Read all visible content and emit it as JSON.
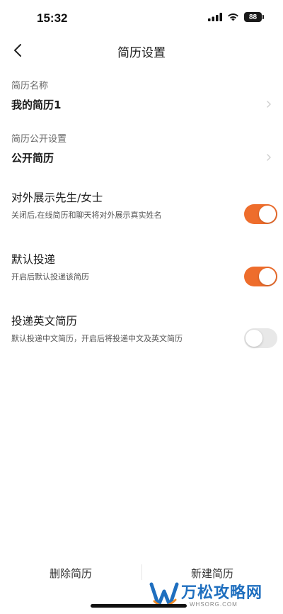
{
  "status_bar": {
    "time": "15:32",
    "battery": "88",
    "icons": [
      "signal-icon",
      "wifi-icon",
      "battery-icon"
    ]
  },
  "header": {
    "back_icon": "chevron-left-icon",
    "title": "简历设置"
  },
  "resume_name": {
    "label": "简历名称",
    "value": "我的简历1"
  },
  "visibility": {
    "label": "简历公开设置",
    "value": "公开简历"
  },
  "toggles": [
    {
      "title": "对外展示先生/女士",
      "description": "关闭后,在线简历和聊天将对外展示真实姓名",
      "enabled": true
    },
    {
      "title": "默认投递",
      "description": "开启后默认投递该简历",
      "enabled": true
    },
    {
      "title": "投递英文简历",
      "description": "默认投递中文简历，开启后将投递中文及英文简历",
      "enabled": false
    }
  ],
  "bottom_bar": {
    "delete_label": "删除简历",
    "new_label": "新建简历"
  },
  "watermark": {
    "title": "万松攻略网",
    "subtitle": "WHSORG.COM"
  },
  "colors": {
    "accent": "#ee6d2c",
    "toggle_off": "#e8e8e8",
    "text_primary": "#1a1a1a",
    "text_secondary": "#666666",
    "watermark_blue": "#1f6fbf"
  }
}
